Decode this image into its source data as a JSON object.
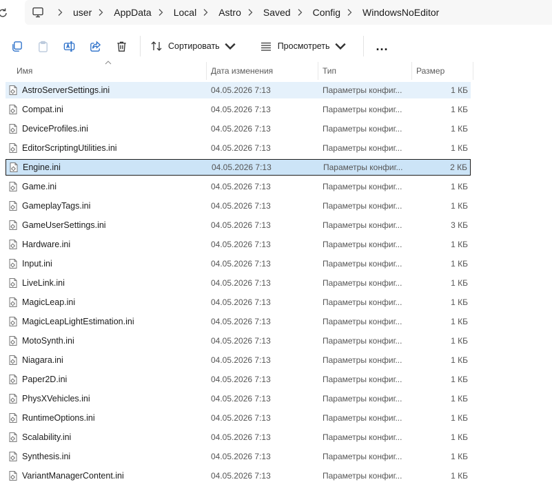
{
  "address": {
    "segments": [
      "user",
      "AppData",
      "Local",
      "Astro",
      "Saved",
      "Config",
      "WindowsNoEditor"
    ]
  },
  "toolbar": {
    "sort_label": "Сортировать",
    "view_label": "Просмотреть",
    "more_label": "..."
  },
  "columns": {
    "name": "Имя",
    "date": "Дата изменения",
    "type": "Тип",
    "size": "Размер"
  },
  "files": [
    {
      "name": "AstroServerSettings.ini",
      "date": "04.05.2026 7:13",
      "type": "Параметры конфиг...",
      "size": "1 КБ"
    },
    {
      "name": "Compat.ini",
      "date": "04.05.2026 7:13",
      "type": "Параметры конфиг...",
      "size": "1 КБ"
    },
    {
      "name": "DeviceProfiles.ini",
      "date": "04.05.2026 7:13",
      "type": "Параметры конфиг...",
      "size": "1 КБ"
    },
    {
      "name": "EditorScriptingUtilities.ini",
      "date": "04.05.2026 7:13",
      "type": "Параметры конфиг...",
      "size": "1 КБ"
    },
    {
      "name": "Engine.ini",
      "date": "04.05.2026 7:13",
      "type": "Параметры конфиг...",
      "size": "2 КБ"
    },
    {
      "name": "Game.ini",
      "date": "04.05.2026 7:13",
      "type": "Параметры конфиг...",
      "size": "1 КБ"
    },
    {
      "name": "GameplayTags.ini",
      "date": "04.05.2026 7:13",
      "type": "Параметры конфиг...",
      "size": "1 КБ"
    },
    {
      "name": "GameUserSettings.ini",
      "date": "04.05.2026 7:13",
      "type": "Параметры конфиг...",
      "size": "3 КБ"
    },
    {
      "name": "Hardware.ini",
      "date": "04.05.2026 7:13",
      "type": "Параметры конфиг...",
      "size": "1 КБ"
    },
    {
      "name": "Input.ini",
      "date": "04.05.2026 7:13",
      "type": "Параметры конфиг...",
      "size": "1 КБ"
    },
    {
      "name": "LiveLink.ini",
      "date": "04.05.2026 7:13",
      "type": "Параметры конфиг...",
      "size": "1 КБ"
    },
    {
      "name": "MagicLeap.ini",
      "date": "04.05.2026 7:13",
      "type": "Параметры конфиг...",
      "size": "1 КБ"
    },
    {
      "name": "MagicLeapLightEstimation.ini",
      "date": "04.05.2026 7:13",
      "type": "Параметры конфиг...",
      "size": "1 КБ"
    },
    {
      "name": "MotoSynth.ini",
      "date": "04.05.2026 7:13",
      "type": "Параметры конфиг...",
      "size": "1 КБ"
    },
    {
      "name": "Niagara.ini",
      "date": "04.05.2026 7:13",
      "type": "Параметры конфиг...",
      "size": "1 КБ"
    },
    {
      "name": "Paper2D.ini",
      "date": "04.05.2026 7:13",
      "type": "Параметры конфиг...",
      "size": "1 КБ"
    },
    {
      "name": "PhysXVehicles.ini",
      "date": "04.05.2026 7:13",
      "type": "Параметры конфиг...",
      "size": "1 КБ"
    },
    {
      "name": "RuntimeOptions.ini",
      "date": "04.05.2026 7:13",
      "type": "Параметры конфиг...",
      "size": "1 КБ"
    },
    {
      "name": "Scalability.ini",
      "date": "04.05.2026 7:13",
      "type": "Параметры конфиг...",
      "size": "1 КБ"
    },
    {
      "name": "Synthesis.ini",
      "date": "04.05.2026 7:13",
      "type": "Параметры конфиг...",
      "size": "1 КБ"
    },
    {
      "name": "VariantManagerContent.ini",
      "date": "04.05.2026 7:13",
      "type": "Параметры конфиг...",
      "size": "1 КБ"
    }
  ],
  "state": {
    "hover_index": 0,
    "selected_index": 4
  },
  "colors": {
    "accent": "#2a6fc9",
    "hover_row": "#e5f1fb",
    "selected_row": "#cce4f7"
  },
  "icons": {
    "refresh": "refresh-icon",
    "this_pc": "this-pc-icon",
    "separator": "chevron-right-icon",
    "copy": "copy-icon",
    "paste": "paste-icon",
    "rename": "rename-icon",
    "share": "share-icon",
    "delete": "trash-icon",
    "sort": "sort-icon",
    "view": "view-icon",
    "file": "config-file-icon"
  }
}
